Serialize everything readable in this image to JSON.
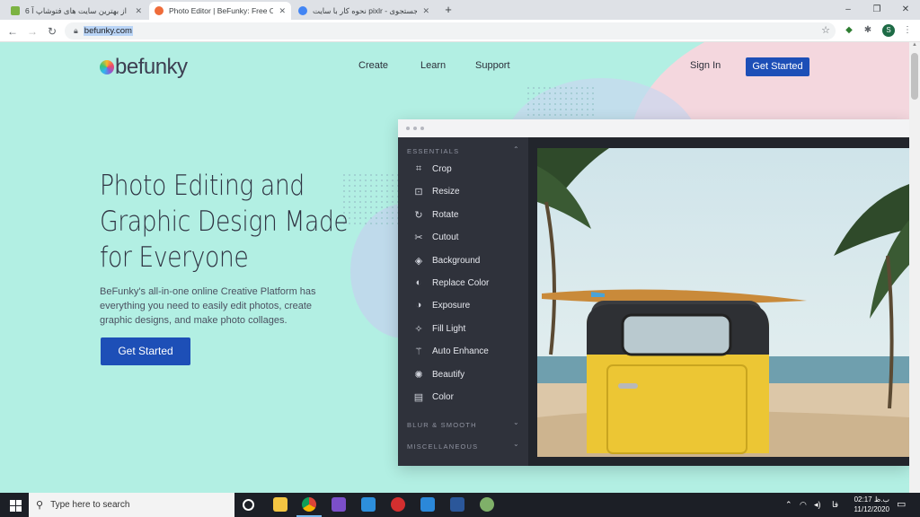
{
  "browser": {
    "tabs": [
      {
        "title": "6 تا از بهترین سایت های فتوشاپ آ",
        "close": "✕",
        "favicon_color": "#7cb342"
      },
      {
        "title": "Photo Editor | BeFunky: Free Onl",
        "close": "✕",
        "favicon_color": "#ef6c3a"
      },
      {
        "title": "نحوه کار با سایت pixlr - جستجوی",
        "close": "✕",
        "favicon_color": "#4285f4"
      }
    ],
    "new_tab": "+",
    "window_controls": {
      "minimize": "–",
      "maximize": "❐",
      "close": "✕"
    },
    "url": "befunky.com",
    "profile_initial": "S"
  },
  "site": {
    "logo_text": "befunky",
    "nav": {
      "create": "Create",
      "learn": "Learn",
      "support": "Support",
      "sign_in": "Sign In",
      "get_started": "Get Started"
    },
    "hero": {
      "title_lines": [
        "Photo Editing and",
        "Graphic Design Made",
        "for Everyone"
      ],
      "subtitle": "BeFunky's all-in-one online Creative Platform has everything you need to easily edit photos, create graphic designs, and make photo collages.",
      "cta": "Get Started"
    },
    "editor": {
      "section_essentials": "ESSENTIALS",
      "tools": [
        {
          "label": "Crop",
          "icon": "crop-icon",
          "glyph": "⌗"
        },
        {
          "label": "Resize",
          "icon": "resize-icon",
          "glyph": "⊡"
        },
        {
          "label": "Rotate",
          "icon": "rotate-icon",
          "glyph": "↻"
        },
        {
          "label": "Cutout",
          "icon": "scissors-icon",
          "glyph": "✂"
        },
        {
          "label": "Background",
          "icon": "background-icon",
          "glyph": "◈"
        },
        {
          "label": "Replace Color",
          "icon": "droplet-icon",
          "glyph": "◐"
        },
        {
          "label": "Exposure",
          "icon": "exposure-icon",
          "glyph": "◑"
        },
        {
          "label": "Fill Light",
          "icon": "light-icon",
          "glyph": "✧"
        },
        {
          "label": "Auto Enhance",
          "icon": "wand-icon",
          "glyph": "⚚"
        },
        {
          "label": "Beautify",
          "icon": "sparkle-icon",
          "glyph": "✺"
        },
        {
          "label": "Color",
          "icon": "palette-icon",
          "glyph": "▤"
        }
      ],
      "section_blur": "BLUR & SMOOTH",
      "section_misc": "MISCELLANEOUS"
    }
  },
  "taskbar": {
    "search_placeholder": "Type here to search",
    "lang": "فا",
    "time": "02:17 ب.ظ",
    "date": "11/12/2020"
  },
  "colors": {
    "accent": "#1d4fb7",
    "page_bg": "#b2efe3",
    "sidebar": "#2f323b"
  }
}
